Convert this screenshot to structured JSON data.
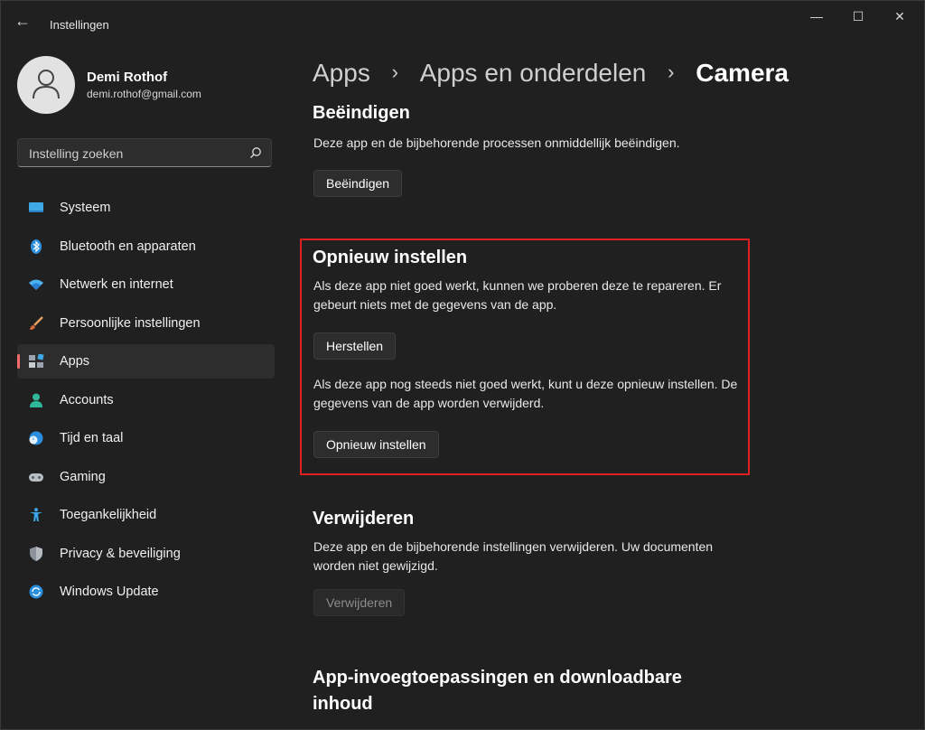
{
  "window": {
    "title": "Instellingen",
    "back_glyph": "←",
    "minimize_glyph": "—",
    "maximize_glyph": "☐",
    "close_glyph": "✕"
  },
  "profile": {
    "name": "Demi Rothof",
    "email": "demi.rothof@gmail.com"
  },
  "search": {
    "placeholder": "Instelling zoeken"
  },
  "nav": {
    "items": [
      {
        "label": "Systeem",
        "icon": "monitor-icon"
      },
      {
        "label": "Bluetooth en apparaten",
        "icon": "bluetooth-icon"
      },
      {
        "label": "Netwerk en internet",
        "icon": "wifi-icon"
      },
      {
        "label": "Persoonlijke instellingen",
        "icon": "brush-icon"
      },
      {
        "label": "Apps",
        "icon": "apps-icon",
        "active": true
      },
      {
        "label": "Accounts",
        "icon": "person-icon"
      },
      {
        "label": "Tijd en taal",
        "icon": "clock-globe-icon"
      },
      {
        "label": "Gaming",
        "icon": "gamepad-icon"
      },
      {
        "label": "Toegankelijkheid",
        "icon": "accessibility-icon"
      },
      {
        "label": "Privacy & beveiliging",
        "icon": "shield-icon"
      },
      {
        "label": "Windows Update",
        "icon": "update-icon"
      }
    ]
  },
  "breadcrumb": {
    "items": [
      "Apps",
      "Apps en onderdelen",
      "Camera"
    ],
    "separator": "›"
  },
  "sections": {
    "terminate": {
      "title": "Beëindigen",
      "description": "Deze app en de bijbehorende processen onmiddellijk beëindigen.",
      "button": "Beëindigen"
    },
    "reset": {
      "title": "Opnieuw instellen",
      "repair_description": "Als deze app niet goed werkt, kunnen we proberen deze te repareren. Er gebeurt niets met de gegevens van de app.",
      "repair_button": "Herstellen",
      "reset_description": "Als deze app nog steeds niet goed werkt, kunt u deze opnieuw instellen. De gegevens van de app worden verwijderd.",
      "reset_button": "Opnieuw instellen"
    },
    "uninstall": {
      "title": "Verwijderen",
      "description": "Deze app en de bijbehorende instellingen verwijderen. Uw documenten worden niet gewijzigd.",
      "button": "Verwijderen"
    },
    "addons": {
      "title": "App-invoegtoepassingen en downloadbare inhoud"
    }
  },
  "colors": {
    "background": "#202020",
    "accent_indicator": "#f06b6b",
    "highlight_border": "#e02020"
  }
}
